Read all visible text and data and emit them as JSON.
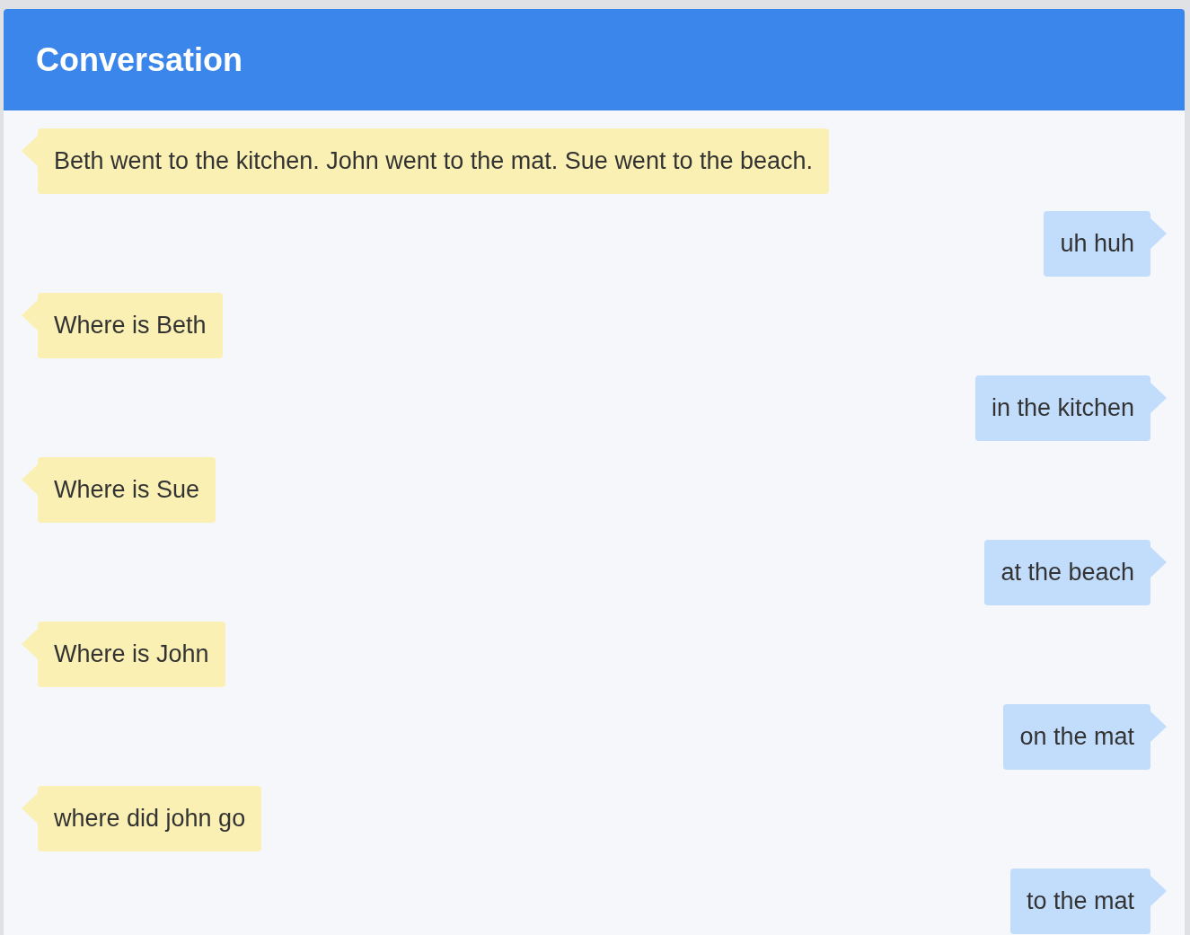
{
  "header": {
    "title": "Conversation"
  },
  "messages": [
    {
      "kind": "incoming",
      "text": "Beth went to the kitchen. John went to the mat. Sue went to the beach."
    },
    {
      "kind": "outgoing",
      "text": "uh huh"
    },
    {
      "kind": "incoming",
      "text": "Where is Beth"
    },
    {
      "kind": "outgoing",
      "text": "in the kitchen"
    },
    {
      "kind": "incoming",
      "text": "Where is Sue"
    },
    {
      "kind": "outgoing",
      "text": "at the beach"
    },
    {
      "kind": "incoming",
      "text": "Where is John"
    },
    {
      "kind": "outgoing",
      "text": "on the mat"
    },
    {
      "kind": "incoming",
      "text": "where did john go"
    },
    {
      "kind": "outgoing",
      "text": "to the mat"
    }
  ]
}
